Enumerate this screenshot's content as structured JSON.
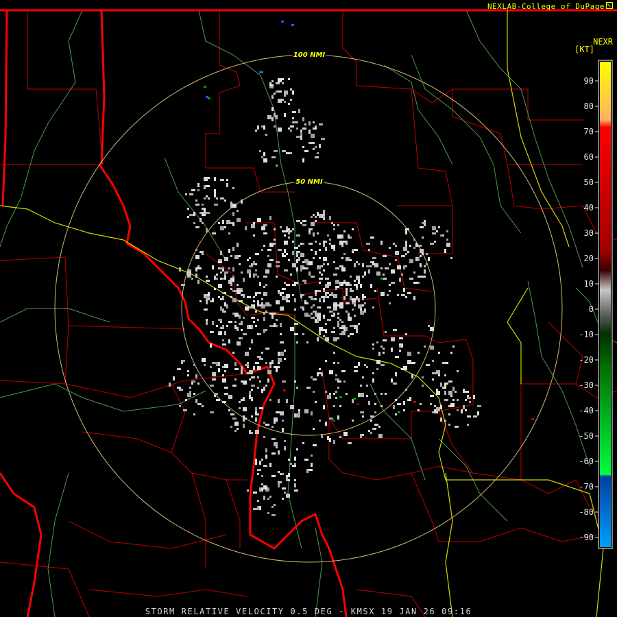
{
  "header": {
    "credit": "NEXLAB-College of DuPage",
    "product_label": "NEXR",
    "unit_label": "[KT]"
  },
  "footer": {
    "caption": "STORM RELATIVE VELOCITY 0.5 DEG - KMSX 19 JAN 26 09:16"
  },
  "range_rings": [
    {
      "label": "50 NMI"
    },
    {
      "label": "100 NMI"
    }
  ],
  "legend": {
    "ticks": [
      "90",
      "80",
      "70",
      "60",
      "50",
      "40",
      "30",
      "20",
      "10",
      "0",
      "-10",
      "-20",
      "-30",
      "-40",
      "-50",
      "-60",
      "-70",
      "-80",
      "-90"
    ],
    "colors": {
      "high": "#ffff00",
      "mid_high": "#ff0000",
      "zero": "#b0b0b0",
      "mid_low": "#00aa00",
      "low": "#0088ff"
    }
  }
}
